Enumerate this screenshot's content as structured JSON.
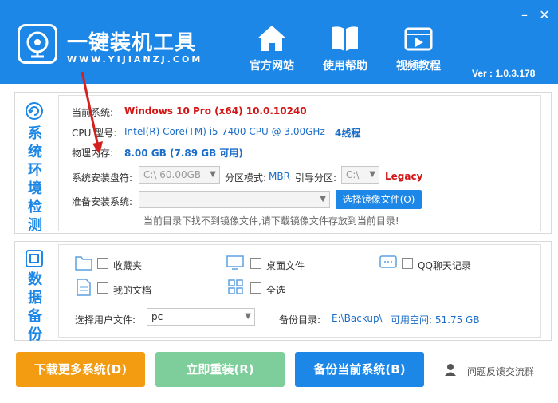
{
  "header": {
    "title": "一键装机工具",
    "url": "WWW.YIJIANZJ.COM",
    "nav": [
      {
        "label": "官方网站",
        "icon": "home-icon"
      },
      {
        "label": "使用帮助",
        "icon": "book-icon"
      },
      {
        "label": "视频教程",
        "icon": "video-icon"
      }
    ],
    "version": "Ver : 1.0.3.178"
  },
  "env": {
    "section": [
      "系",
      "统",
      "环",
      "境",
      "检",
      "测"
    ],
    "os_label": "当前系统:",
    "os_value": "Windows 10 Pro (x64) 10.0.10240",
    "cpu_label": "CPU 型号:",
    "cpu_value": "Intel(R) Core(TM) i5-7400 CPU @ 3.00GHz",
    "cpu_threads": "4线程",
    "mem_label": "物理内存:",
    "mem_value": "8.00 GB (7.89 GB 可用)",
    "disk_label": "系统安装盘符:",
    "disk_value": "C:\\  60.00GB",
    "partition_label": "分区模式:",
    "partition_value": "MBR",
    "boot_label": "引导分区:",
    "boot_value": "C:\\",
    "boot_mode": "Legacy",
    "prepare_label": "准备安装系统:",
    "choose_image_button": "选择镜像文件(O)",
    "warning": "当前目录下找不到镜像文件,请下载镜像文件存放到当前目录!"
  },
  "backup": {
    "section": [
      "数",
      "据",
      "备",
      "份"
    ],
    "items": [
      {
        "label": "收藏夹",
        "icon": "folder-icon"
      },
      {
        "label": "桌面文件",
        "icon": "monitor-icon"
      },
      {
        "label": "QQ聊天记录",
        "icon": "chat-icon"
      },
      {
        "label": "我的文档",
        "icon": "document-icon"
      },
      {
        "label": "全选",
        "icon": "grid-icon"
      }
    ],
    "user_label": "选择用户文件:",
    "user_value": "pc",
    "dir_label": "备份目录:",
    "dir_value": "E:\\Backup\\",
    "free_space": "可用空间: 51.75 GB"
  },
  "buttons": {
    "download": "下载更多系统(D)",
    "reinstall": "立即重装(R)",
    "backup": "备份当前系统(B)",
    "feedback": "问题反馈交流群"
  },
  "colors": {
    "header": "#1c87e7",
    "orange": "#f39c12",
    "green": "#7dce9a",
    "blue": "#1c87e7"
  }
}
